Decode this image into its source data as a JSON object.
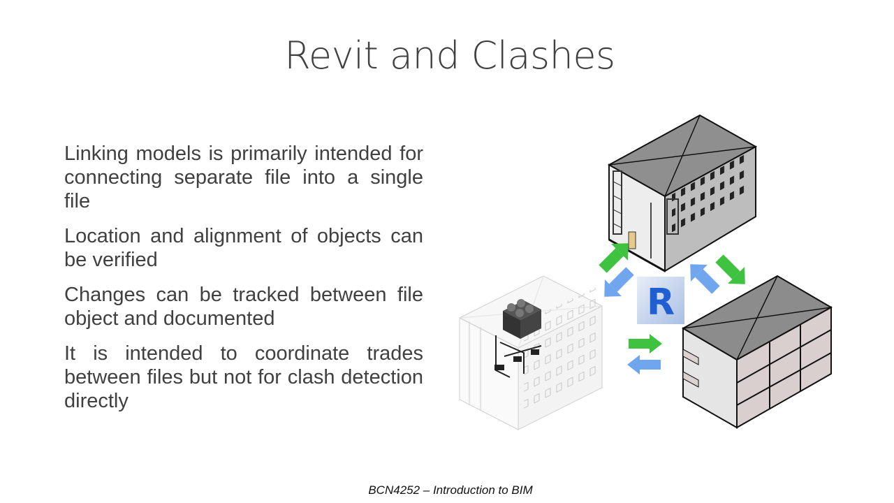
{
  "slide": {
    "title": "Revit and Clashes",
    "bullets": [
      "Linking models is primarily intended for connecting separate file into a single file",
      "Location and alignment of objects can be verified",
      "Changes can be tracked between file object and documented",
      "It is intended to coordinate trades between files but not for clash detection directly"
    ],
    "footer": "BCN4252 – Introduction to BIM"
  },
  "figure": {
    "logo_letter": "R",
    "colors": {
      "arrow_green": "#3fc23f",
      "arrow_blue": "#6fa6ee",
      "logo_blue": "#1f5fd1",
      "roof_gray": "#8c8c8c"
    }
  }
}
